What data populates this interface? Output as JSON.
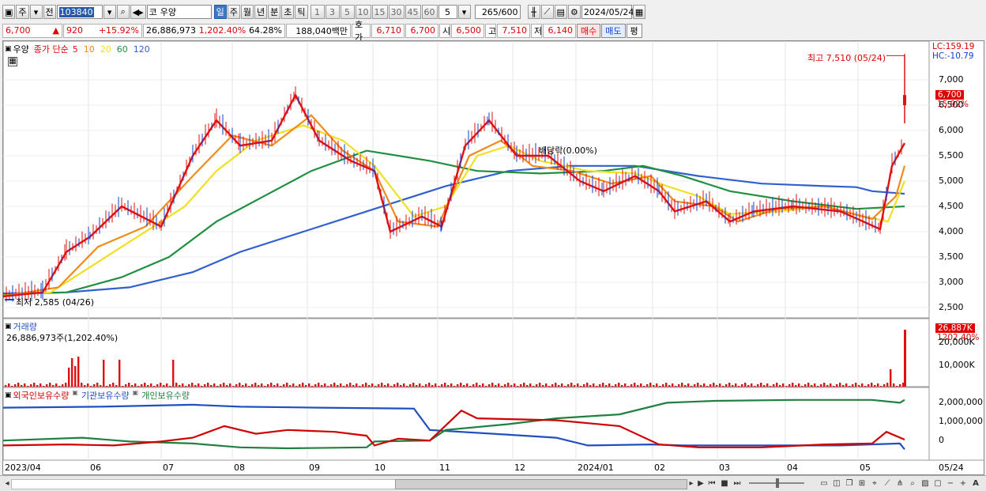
{
  "toolbar": {
    "period_label": "주",
    "prev_label": "전",
    "stock_code": "103840",
    "market_label": "코",
    "stock_name": "우양",
    "timeframes": [
      "일",
      "주",
      "월",
      "년",
      "분",
      "초",
      "틱"
    ],
    "active_timeframe": "일",
    "numbers": [
      "1",
      "3",
      "5",
      "10",
      "15",
      "30",
      "45",
      "60"
    ],
    "interval_value": "5",
    "count_current": "265",
    "count_total": "/600",
    "date": "2024/05/24"
  },
  "quote": {
    "price": "6,700",
    "up_arrow": "▲",
    "change": "920",
    "change_pct": "+15.92%",
    "volume": "26,886,973",
    "volume_ratio": "1,202.40%",
    "turnover_pct": "64.28%",
    "amount": "188,040백만",
    "hoga_label": "호가",
    "ask": "6,710",
    "bid": "6,700",
    "open_label": "시",
    "open": "6,500",
    "high_label": "고",
    "high": "7,510",
    "low_label": "저",
    "low": "6,140",
    "buy_label": "매수",
    "sell_label": "매도",
    "avg_label": "평"
  },
  "price_panel": {
    "name": "우양",
    "legend_title": "종가 단순",
    "ma_legend": [
      {
        "label": "5",
        "color": "#e01010"
      },
      {
        "label": "10",
        "color": "#f08a1a"
      },
      {
        "label": "20",
        "color": "#f0e020"
      },
      {
        "label": "60",
        "color": "#209040"
      },
      {
        "label": "120",
        "color": "#3060d0"
      }
    ],
    "lc_label": "LC:159.19",
    "hc_label": "HC:-10.79",
    "high_annotation": "최고 7,510 (05/24)",
    "low_annotation": "최저 2,585 (04/26)",
    "dividend_annotation": "배당락(0.00%)",
    "current_price_tag": "6,700",
    "current_pct_tag": "15.92%",
    "y_ticks": [
      "7,000",
      "6,500",
      "6,000",
      "5,500",
      "5,000",
      "4,500",
      "4,000",
      "3,500",
      "3,000",
      "2,500"
    ]
  },
  "volume_panel": {
    "title": "거래량",
    "summary": "26,886,973주(1,202.40%)",
    "value_tag": "26,887K",
    "pct_tag": "1202.40%",
    "y_ticks": [
      "20,000K",
      "10,000K"
    ]
  },
  "holding_panel": {
    "legend": [
      {
        "label": "외국인보유수량",
        "color": "#d00000"
      },
      {
        "label": "기관보유수량",
        "color": "#2050c0"
      },
      {
        "label": "개인보유수량",
        "color": "#208040"
      }
    ],
    "y_ticks": [
      "2,000,000",
      "1,000,000",
      "0"
    ]
  },
  "x_axis": {
    "labels": [
      "2023/04",
      "06",
      "07",
      "08",
      "09",
      "10",
      "11",
      "12",
      "2024/01",
      "02",
      "03",
      "04",
      "05",
      "05/24"
    ]
  },
  "bottom_bar": {
    "nav_icons": [
      "play-right-icon",
      "step-back-icon",
      "stop-icon",
      "fast-forward-icon"
    ]
  }
}
